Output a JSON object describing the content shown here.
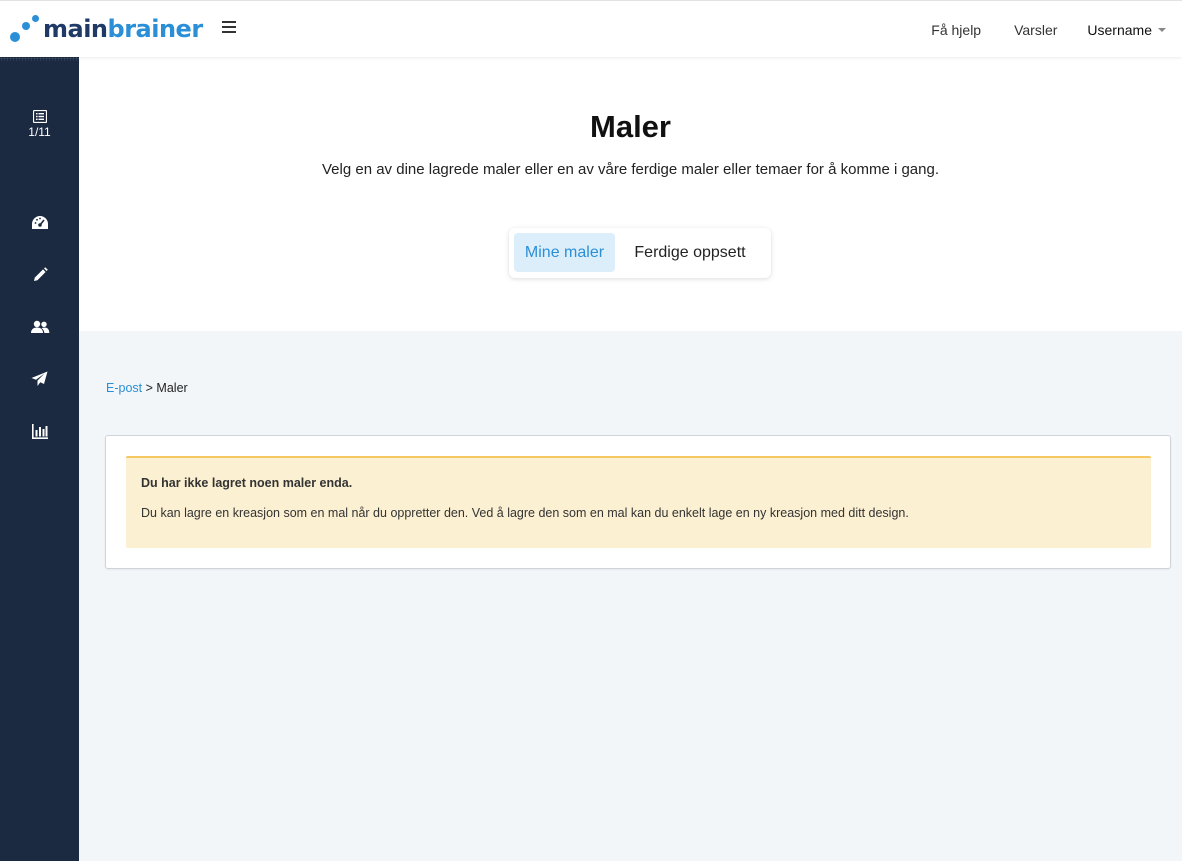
{
  "brand": {
    "part1": "main",
    "part2": "brainer",
    "colors": {
      "dark": "#1f3a66",
      "accent": "#2a8fd6"
    }
  },
  "topnav": {
    "help": "Få hjelp",
    "alerts": "Varsler",
    "user": "Username"
  },
  "sidebar": {
    "counter": "1/11",
    "items": [
      {
        "icon": "dashboard-icon"
      },
      {
        "icon": "pencil-icon"
      },
      {
        "icon": "users-icon"
      },
      {
        "icon": "paper-plane-icon"
      },
      {
        "icon": "bar-chart-icon"
      }
    ]
  },
  "page": {
    "title": "Maler",
    "subtitle": "Velg en av dine lagrede maler eller en av våre ferdige maler eller temaer for å komme i gang.",
    "tabs": [
      {
        "label": "Mine maler",
        "active": true
      },
      {
        "label": "Ferdige oppsett",
        "active": false
      }
    ]
  },
  "breadcrumb": {
    "link": "E-post",
    "separator": ">",
    "current": "Maler"
  },
  "alert": {
    "title": "Du har ikke lagret noen maler enda.",
    "text": "Du kan lagre en kreasjon som en mal når du oppretter den. Ved å lagre den som en mal kan du enkelt lage en ny kreasjon med ditt design."
  }
}
